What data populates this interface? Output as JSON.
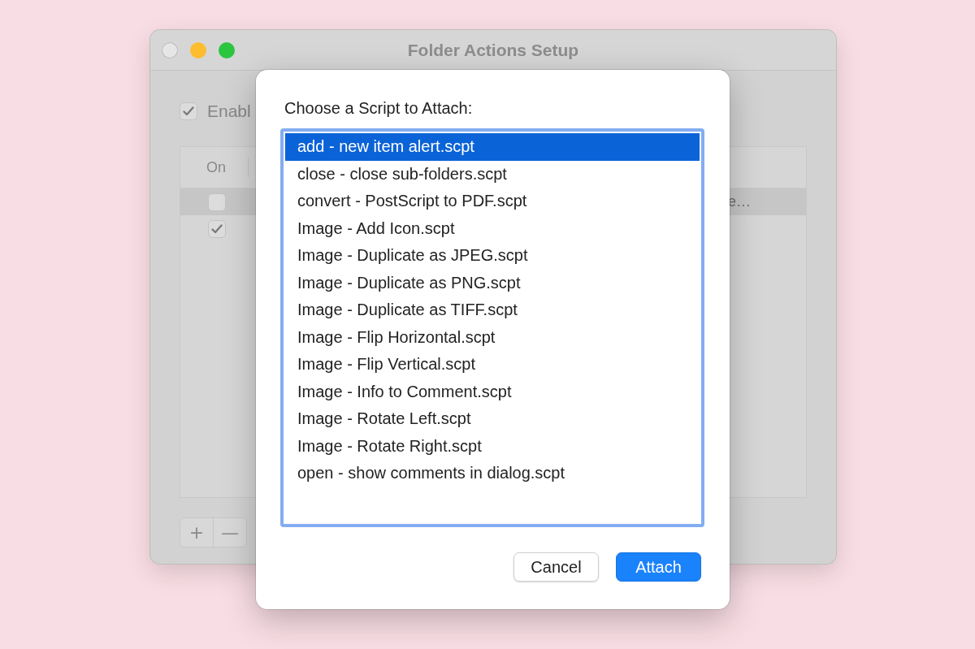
{
  "window": {
    "title": "Folder Actions Setup"
  },
  "enable_checkbox": {
    "label": "Enabl",
    "checked": true
  },
  "table": {
    "columns": [
      "On"
    ],
    "rows": [
      {
        "on": false,
        "selected": true,
        "column_2": "e…"
      },
      {
        "on": true,
        "selected": false
      }
    ]
  },
  "table_buttons": [
    "+",
    "—"
  ],
  "sheet": {
    "prompt": "Choose a Script to Attach:",
    "scripts": [
      {
        "label": "add - new item alert.scpt",
        "selected": true
      },
      {
        "label": "close - close sub-folders.scpt",
        "selected": false
      },
      {
        "label": "convert - PostScript to PDF.scpt",
        "selected": false
      },
      {
        "label": "Image - Add Icon.scpt",
        "selected": false
      },
      {
        "label": "Image - Duplicate as JPEG.scpt",
        "selected": false
      },
      {
        "label": "Image - Duplicate as PNG.scpt",
        "selected": false
      },
      {
        "label": "Image - Duplicate as TIFF.scpt",
        "selected": false
      },
      {
        "label": "Image - Flip Horizontal.scpt",
        "selected": false
      },
      {
        "label": "Image - Flip Vertical.scpt",
        "selected": false
      },
      {
        "label": "Image - Info to Comment.scpt",
        "selected": false
      },
      {
        "label": "Image - Rotate Left.scpt",
        "selected": false
      },
      {
        "label": "Image - Rotate Right.scpt",
        "selected": false
      },
      {
        "label": "open - show comments in dialog.scpt",
        "selected": false
      }
    ],
    "buttons": [
      {
        "label": "Cancel",
        "kind": "secondary"
      },
      {
        "label": "Attach",
        "kind": "primary"
      }
    ]
  }
}
